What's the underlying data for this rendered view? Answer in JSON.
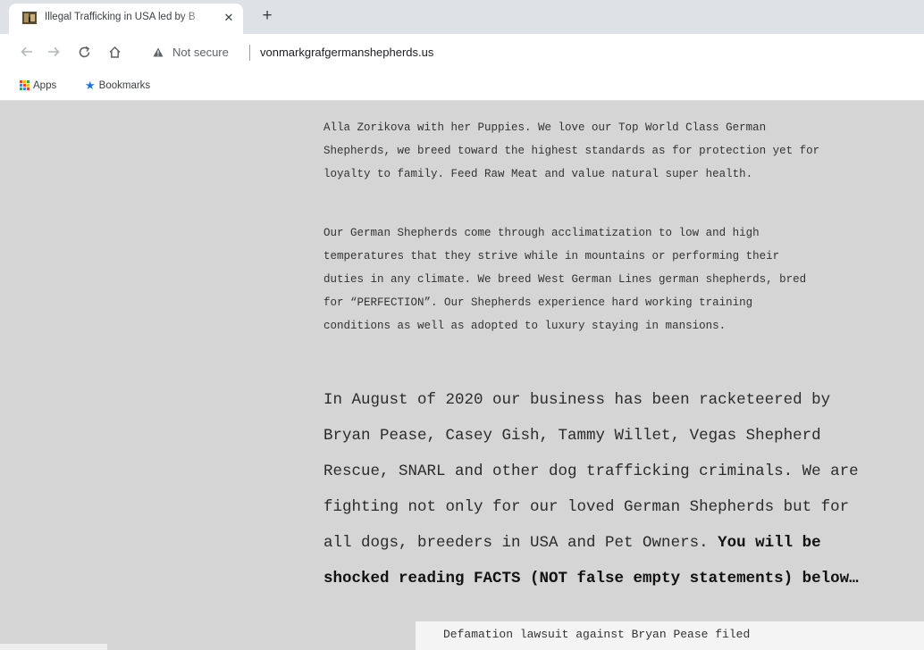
{
  "browser": {
    "tab": {
      "title": "Illegal Trafficking in USA led by B",
      "favicon": "site-favicon",
      "close_glyph": "✕"
    },
    "new_tab_glyph": "+",
    "nav": {
      "back_icon": "back-arrow-icon",
      "forward_icon": "forward-arrow-icon",
      "reload_icon": "reload-icon",
      "home_icon": "home-icon"
    },
    "omnibox": {
      "security_label": "Not secure",
      "url": "vonmarkgrafgermanshepherds.us"
    },
    "bookmarks_bar": {
      "items": [
        {
          "label": "Apps",
          "icon": "apps-grid-icon"
        },
        {
          "label": "Bookmarks",
          "icon": "star-icon"
        }
      ]
    },
    "colors": {
      "tabstrip": "#dee1e6",
      "page_background": "#d5d5d5",
      "bookmark_star": "#1a73e8"
    }
  },
  "content": {
    "intro_lines": [
      "Alla Zorikova with her Puppies. We love our Top World Class German",
      "Shepherds, we breed toward the highest standards as for protection yet for",
      "loyalty to family. Feed Raw Meat and value natural super health."
    ],
    "climate_lines": [
      "Our German Shepherds come through acclimatization to low and high",
      "temperatures that they strive while in mountains or performing their",
      "duties in any climate. We breed West German Lines german shepherds, bred",
      "for “PERFECTION”. Our Shepherds experience hard working training",
      "conditions as well as adopted to luxury staying in mansions."
    ],
    "statement": {
      "line1": "In August of 2020 our business has been racketeered by",
      "line2": "Bryan Pease, Casey Gish, Tammy Willet, Vegas Shepherd",
      "line3": "Rescue, SNARL and other dog trafficking criminals. We are",
      "line4": "fighting not only for our loved German Shepherds but for",
      "line5_plain": "all dogs, breeders in USA and Pet Owners. ",
      "line5_bold": "You will be",
      "line6_bold": "shocked reading FACTS (NOT false empty statements) below…"
    },
    "caption": "Defamation lawsuit against Bryan Pease filed"
  }
}
